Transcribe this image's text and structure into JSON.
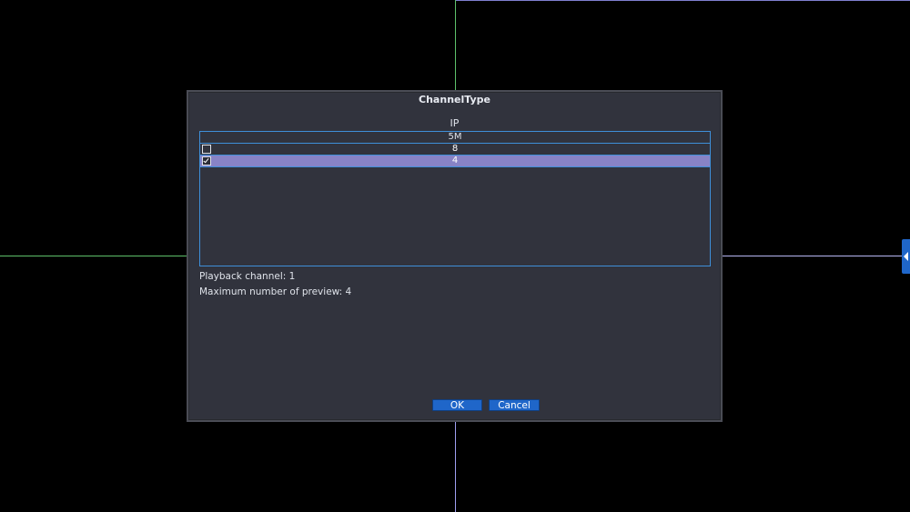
{
  "dialog": {
    "title": "ChannelType",
    "group_label": "IP",
    "list": {
      "header": "5M",
      "rows": [
        {
          "label": "8",
          "checked": false,
          "selected": false
        },
        {
          "label": "4",
          "checked": true,
          "selected": true
        }
      ]
    },
    "playback_text": "Playback channel: 1",
    "preview_text": "Maximum number of preview: 4",
    "ok_label": "OK",
    "cancel_label": "Cancel"
  },
  "colors": {
    "background": "#000000",
    "dialog_bg": "#31333d",
    "list_border": "#3e8fd9",
    "selected_row": "#8883c6",
    "button": "#1f66c9",
    "grid_green": "#5ec06a",
    "grid_purple": "#9e9ef0"
  },
  "side_tab": {
    "icon": "chevron-left-icon"
  }
}
